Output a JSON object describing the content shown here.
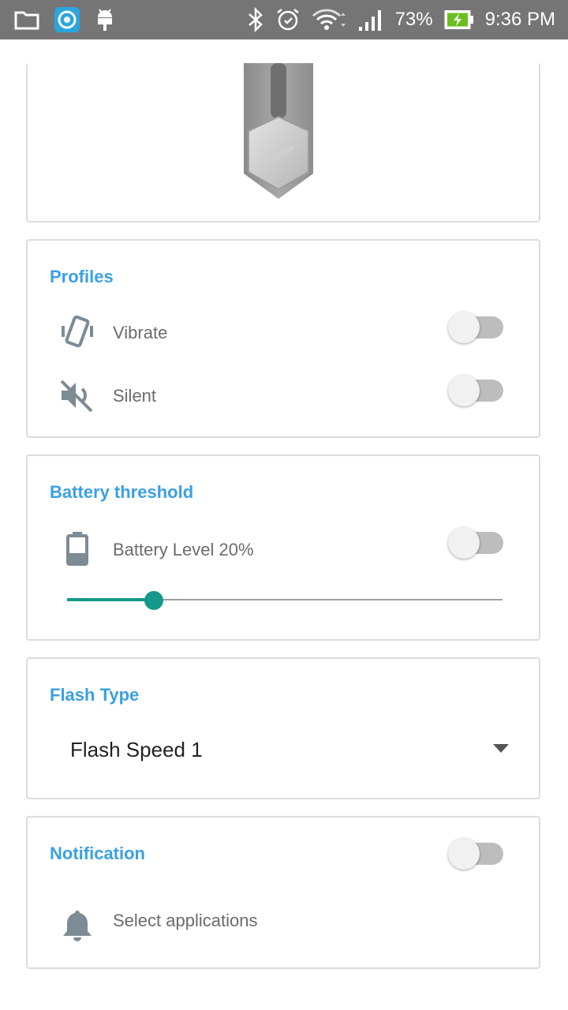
{
  "status_bar": {
    "battery_percent": "73%",
    "time": "9:36 PM",
    "left_icons": [
      "folder-icon",
      "app-icon",
      "android-debug-icon"
    ],
    "right_icons": [
      "bluetooth-icon",
      "alarm-icon",
      "wifi-icon",
      "signal-icon",
      "battery-charging-icon"
    ]
  },
  "colors": {
    "accent_blue": "#3aa0e4",
    "teal": "#14988a",
    "status_bar": "#757575",
    "label_gray": "#6b6b6b"
  },
  "profiles": {
    "title": "Profiles",
    "items": [
      {
        "icon": "vibrate-icon",
        "label": "Vibrate",
        "enabled": false
      },
      {
        "icon": "silent-icon",
        "label": "Silent",
        "enabled": false
      }
    ]
  },
  "battery": {
    "title": "Battery threshold",
    "icon": "battery-icon",
    "label": "Battery Level 20%",
    "enabled": false,
    "slider_fraction": 0.2
  },
  "flash": {
    "title": "Flash Type",
    "selected": "Flash Speed 1"
  },
  "notification": {
    "title": "Notification",
    "enabled": false,
    "icon": "bell-icon",
    "select_label": "Select applications"
  }
}
